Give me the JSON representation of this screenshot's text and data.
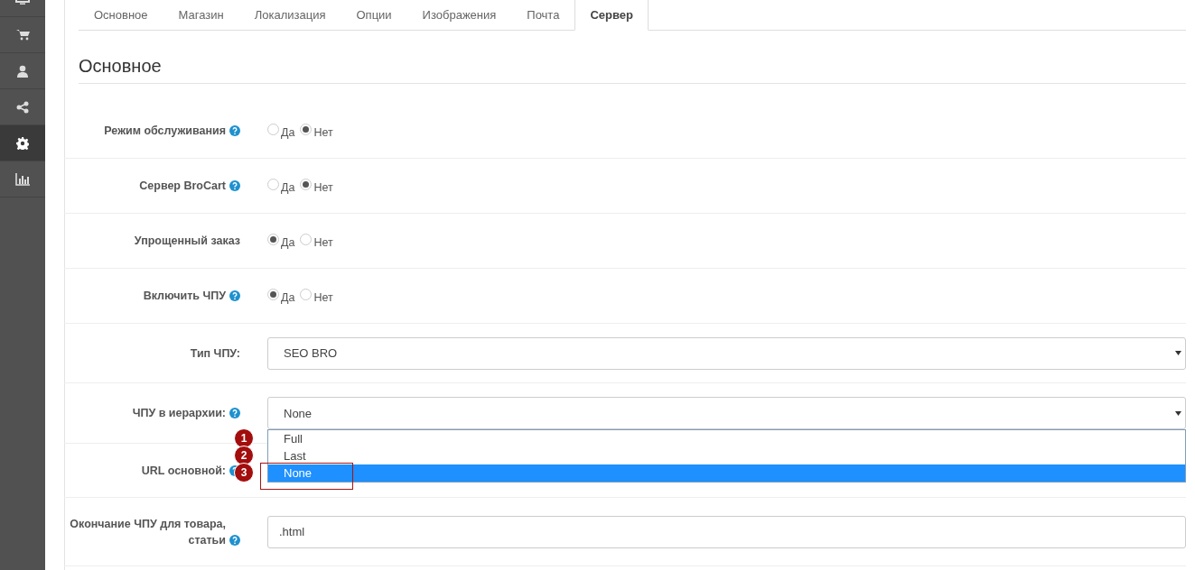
{
  "sidebar": {
    "items": [
      {
        "kind": "monitor",
        "selected": false
      },
      {
        "kind": "cart",
        "selected": false
      },
      {
        "kind": "user",
        "selected": false
      },
      {
        "kind": "share",
        "selected": false
      },
      {
        "kind": "gear",
        "selected": true
      },
      {
        "kind": "chart",
        "selected": false
      }
    ]
  },
  "tabs": [
    {
      "label": "Основное",
      "selected": false
    },
    {
      "label": "Магазин",
      "selected": false
    },
    {
      "label": "Локализация",
      "selected": false
    },
    {
      "label": "Опции",
      "selected": false
    },
    {
      "label": "Изображения",
      "selected": false
    },
    {
      "label": "Почта",
      "selected": false
    },
    {
      "label": "Сервер",
      "selected": true
    }
  ],
  "section_title": "Основное",
  "fields": [
    {
      "kind": "radio",
      "label": "Режим обслуживания",
      "help": true,
      "options": [
        {
          "label": "Да",
          "selected": false
        },
        {
          "label": "Нет",
          "selected": true
        }
      ]
    },
    {
      "kind": "radio",
      "label": "Сервер BroCart",
      "help": true,
      "options": [
        {
          "label": "Да",
          "selected": false
        },
        {
          "label": "Нет",
          "selected": true
        }
      ]
    },
    {
      "kind": "radio",
      "label": "Упрощенный заказ",
      "options": [
        {
          "label": "Да",
          "selected": true
        },
        {
          "label": "Нет",
          "selected": false
        }
      ]
    },
    {
      "kind": "radio",
      "label": "Включить ЧПУ",
      "help": true,
      "options": [
        {
          "label": "Да",
          "selected": true
        },
        {
          "label": "Нет",
          "selected": false
        }
      ]
    },
    {
      "kind": "select",
      "label": "Тип ЧПУ:",
      "value": "SEO BRO"
    },
    {
      "kind": "select",
      "label": "ЧПУ в иерархии:",
      "help": true,
      "value": "None",
      "dropdown": [
        {
          "label": "Full",
          "selected": false,
          "badge": "1"
        },
        {
          "label": "Last",
          "selected": false,
          "badge": "2"
        },
        {
          "label": "None",
          "selected": true,
          "badge": "3",
          "outlined": true
        }
      ]
    },
    {
      "kind": "covered",
      "label": "URL основной:",
      "help": true
    },
    {
      "kind": "text",
      "label": "Окончание ЧПУ для товара, статьи",
      "help": true,
      "value": ".html"
    }
  ]
}
